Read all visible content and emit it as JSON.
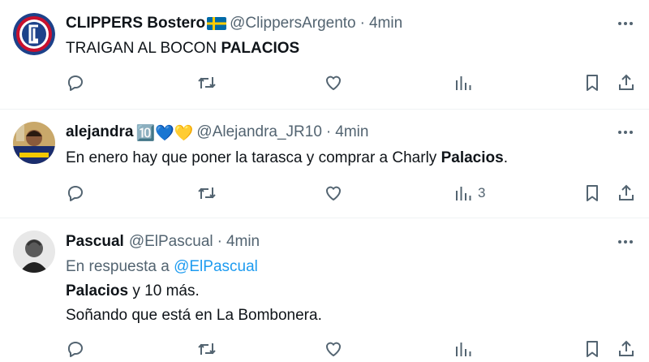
{
  "tweets": [
    {
      "name": "CLIPPERS Bostero",
      "handle": "@ClippersArgento",
      "sep": "·",
      "time": "4min",
      "text_plain": "TRAIGAN AL BOCON ",
      "text_bold": "PALACIOS",
      "views": ""
    },
    {
      "name": "alejandra",
      "badge": "🔟💙💛",
      "handle": "@Alejandra_JR10",
      "sep": "·",
      "time": "4min",
      "text_plain": "En enero hay que poner la tarasca y comprar a Charly ",
      "text_bold": "Palacios",
      "text_end": ".",
      "views": "3"
    },
    {
      "name": "Pascual",
      "handle": "@ElPascual",
      "sep": "·",
      "time": "4min",
      "reply_prefix": "En respuesta a ",
      "reply_handle": "@ElPascual",
      "line1_bold": "Palacios",
      "line1_rest": " y 10 más.",
      "line2": "Soñando que está en La Bombonera.",
      "views": ""
    }
  ],
  "icons": {
    "reply": "reply-icon",
    "retweet": "retweet-icon",
    "like": "heart-icon",
    "views": "views-icon",
    "bookmark": "bookmark-icon",
    "share": "share-icon",
    "more": "more-icon"
  },
  "colors": {
    "text": "#0f1419",
    "secondary": "#536471",
    "link": "#1d9bf0",
    "divider": "#eff3f4"
  }
}
